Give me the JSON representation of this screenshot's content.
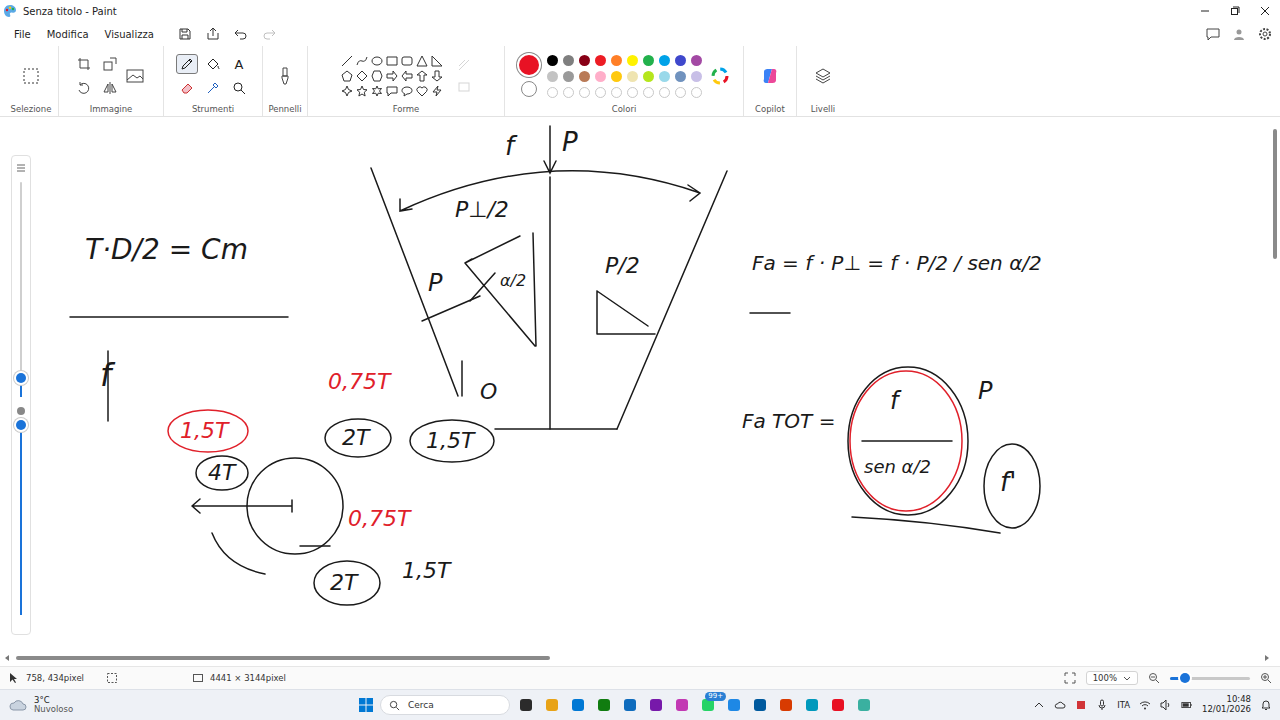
{
  "window": {
    "title": "Senza titolo - Paint"
  },
  "menu": [
    {
      "label": "File"
    },
    {
      "label": "Modifica"
    },
    {
      "label": "Visualizza"
    }
  ],
  "quick_actions": [
    {
      "kind": "save",
      "disabled": false
    },
    {
      "kind": "share",
      "disabled": false
    },
    {
      "kind": "undo",
      "disabled": false
    },
    {
      "kind": "redo",
      "disabled": true
    }
  ],
  "ribbon": {
    "groups": [
      {
        "label": "Selezione",
        "kind": "selection"
      },
      {
        "label": "Immagine",
        "kind": "image"
      },
      {
        "label": "Strumenti",
        "kind": "tools"
      },
      {
        "label": "Pennelli",
        "kind": "brushes"
      },
      {
        "label": "Forme",
        "kind": "shapes"
      },
      {
        "label": "Colori",
        "kind": "colors"
      },
      {
        "label": "Copilot",
        "kind": "copilot"
      },
      {
        "label": "Livelli",
        "kind": "layers"
      }
    ]
  },
  "tools": [
    {
      "kind": "pencil",
      "selected": true
    },
    {
      "kind": "fill",
      "selected": false
    },
    {
      "kind": "text",
      "glyph": "A",
      "selected": false
    },
    {
      "kind": "eraser",
      "selected": false
    },
    {
      "kind": "picker",
      "selected": false
    },
    {
      "kind": "zoom",
      "selected": false
    }
  ],
  "colors": {
    "primary": "#e81224",
    "secondary": "#ffffff",
    "palette": [
      {
        "color": "#000000"
      },
      {
        "color": "#7f7f7f"
      },
      {
        "color": "#880015"
      },
      {
        "color": "#ed1c24"
      },
      {
        "color": "#ff7f27"
      },
      {
        "color": "#fff200"
      },
      {
        "color": "#22b14c"
      },
      {
        "color": "#00a2e8"
      },
      {
        "color": "#3f48cc"
      },
      {
        "color": "#a349a4"
      },
      {
        "color": "#c3c3c3"
      },
      {
        "color": "#9a9a9a"
      },
      {
        "color": "#b97a57"
      },
      {
        "color": "#ffaec9"
      },
      {
        "color": "#ffc90e"
      },
      {
        "color": "#efe4b0"
      },
      {
        "color": "#b5e61d"
      },
      {
        "color": "#99d9ea"
      },
      {
        "color": "#7092be"
      },
      {
        "color": "#c8bfe7"
      }
    ]
  },
  "sliders": [
    {
      "kind": "size",
      "level": 0.09
    },
    {
      "kind": "opacity",
      "level": 1
    }
  ],
  "scrollbars": {
    "horizontal_level": 0.43,
    "vertical_level": 0.25
  },
  "canvas": {
    "annotations": [
      {
        "text": "f",
        "color": "#1a1a1a"
      },
      {
        "text": "P",
        "color": "#1a1a1a"
      },
      {
        "text": "P⊥/2",
        "color": "#1a1a1a"
      },
      {
        "text": "P",
        "color": "#1a1a1a"
      },
      {
        "text": "α/2",
        "color": "#1a1a1a"
      },
      {
        "text": "P/2",
        "color": "#1a1a1a"
      },
      {
        "text": "O",
        "color": "#1a1a1a"
      },
      {
        "text": "0,75T",
        "color": "#e0202a"
      },
      {
        "text": "2T",
        "color": "#1a1a1a"
      },
      {
        "text": "1,5T",
        "color": "#1a1a1a"
      },
      {
        "text": "1,5T",
        "color": "#e0202a"
      },
      {
        "text": "4T",
        "color": "#1a1a1a"
      },
      {
        "text": "0,75T",
        "color": "#e0202a"
      },
      {
        "text": "2T",
        "color": "#1a1a1a"
      },
      {
        "text": "1,5T",
        "color": "#1a1a1a"
      },
      {
        "text": "T·D/2 = Cm",
        "color": "#1a1a1a"
      },
      {
        "text": "f",
        "color": "#1a1a1a"
      },
      {
        "text": "Fa = f · P⊥ = f · P/2 / sen α/2",
        "color": "#1a1a1a"
      },
      {
        "text": "Fa TOT =",
        "color": "#1a1a1a"
      },
      {
        "text": "f",
        "color": "#1a1a1a"
      },
      {
        "text": "P",
        "color": "#1a1a1a"
      },
      {
        "text": "sen α/2",
        "color": "#1a1a1a"
      },
      {
        "text": "f'",
        "color": "#1a1a1a"
      }
    ]
  },
  "status_bar": {
    "cursor": "758, 434pixel",
    "canvas_size": "4441 × 3144pixel",
    "zoom": "100%",
    "zoom_level": 0.19
  },
  "taskbar": {
    "weather_temp": "3°C",
    "weather_text": "Nuvoloso",
    "search": "Cerca",
    "badge": "99+",
    "language": "ITA",
    "time": "10:48",
    "date": "12/01/2026"
  }
}
